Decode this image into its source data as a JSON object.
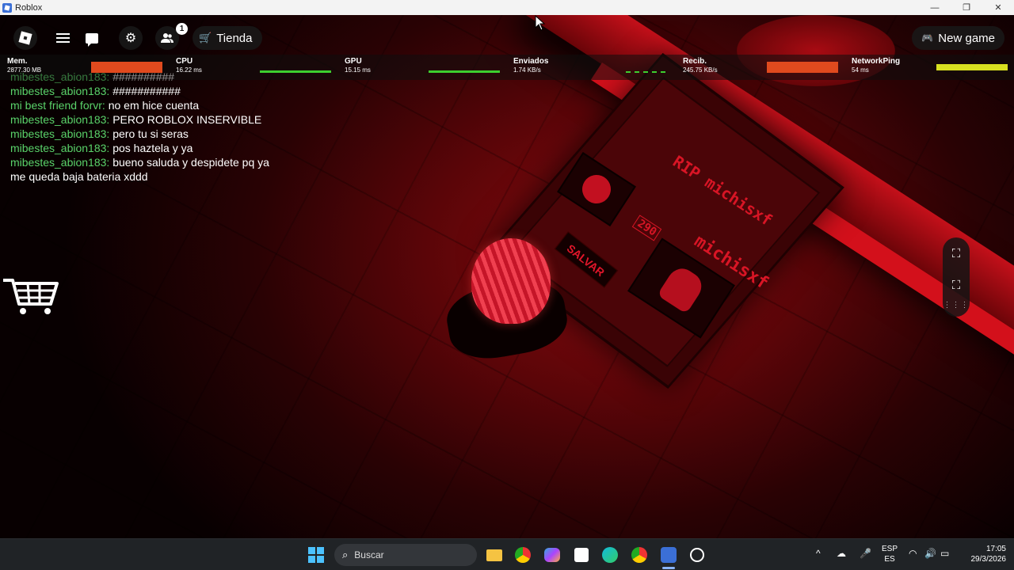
{
  "window": {
    "title": "Roblox",
    "minimize": "—",
    "maximize": "❐",
    "close": "✕"
  },
  "hud": {
    "shop_label": "Tienda",
    "new_game_label": "New game",
    "friends_badge": "1"
  },
  "stats": [
    {
      "label": "Mem.",
      "value": "2877.30 MB"
    },
    {
      "label": "CPU",
      "value": "16.22 ms"
    },
    {
      "label": "GPU",
      "value": "15.15 ms"
    },
    {
      "label": "Enviados",
      "value": "1.74 KB/s"
    },
    {
      "label": "Recib.",
      "value": "245.75 KB/s"
    },
    {
      "label": "NetworkPing",
      "value": "54 ms"
    }
  ],
  "chat": [
    {
      "user": "mibestes_abion183:",
      "text": "##########"
    },
    {
      "user": "mibestes_abion183:",
      "text": "###########"
    },
    {
      "user": "mi best friend forvr:",
      "text": "no em hice cuenta"
    },
    {
      "user": "mibestes_abion183:",
      "text": "PERO ROBLOX INSERVIBLE"
    },
    {
      "user": "mibestes_abion183:",
      "text": "pero tu si seras"
    },
    {
      "user": "mibestes_abion183:",
      "text": "pos haztela y ya"
    },
    {
      "user": "mibestes_abion183:",
      "text": "bueno saluda y despidete pq ya"
    },
    {
      "user": "",
      "text": "me queda baja bateria xddd"
    }
  ],
  "scene": {
    "rip_text": "RIP michisxf",
    "name_text": "michisxf",
    "number_text": "290",
    "salvar_text": "SALVAR"
  },
  "taskbar": {
    "search_placeholder": "Buscar",
    "lang_top": "ESP",
    "lang_bottom": "ES",
    "time": "17:05",
    "date": "29/3/2026"
  },
  "colors": {
    "chat_user": "#5ad36a",
    "stat_orange": "#e04a1e",
    "stat_yellow": "#d8e020",
    "stat_green": "#3dcf2f",
    "scene_red": "#c4101a"
  }
}
